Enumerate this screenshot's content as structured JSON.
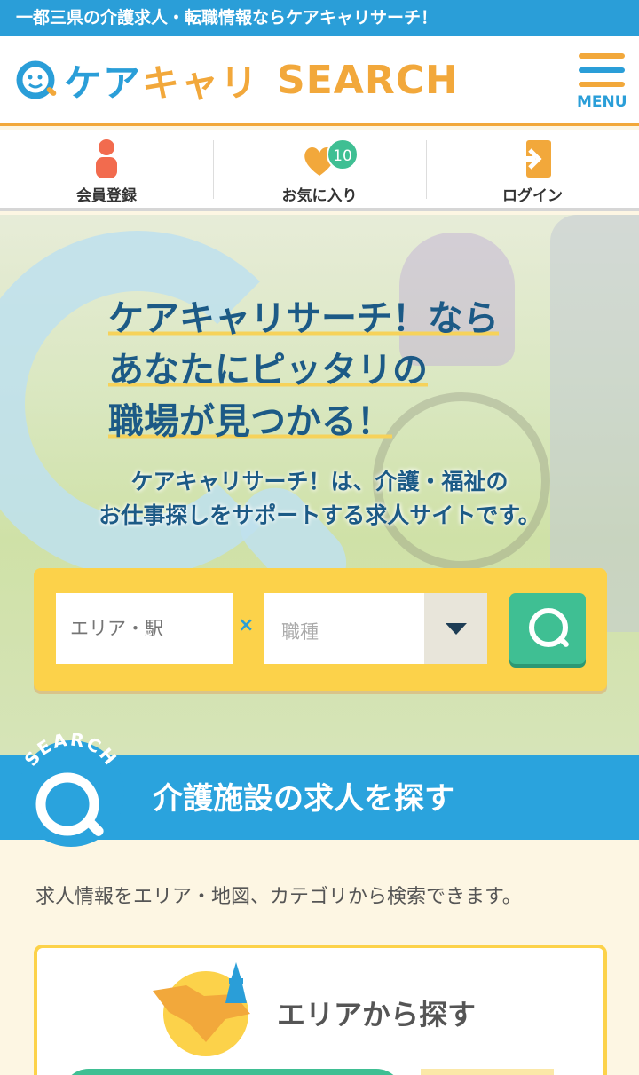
{
  "topbar": {
    "text": "一都三県の介護求人・転職情報ならケアキャリサーチ！"
  },
  "header": {
    "logo_kana_1": "ケア",
    "logo_kana_2": "キャリ",
    "logo_latin": "SEARCH",
    "menu_label": "MENU"
  },
  "quicknav": {
    "items": [
      {
        "label": "会員登録",
        "icon": "person-icon"
      },
      {
        "label": "お気に入り",
        "icon": "heart-icon",
        "badge": "10"
      },
      {
        "label": "ログイン",
        "icon": "login-icon"
      }
    ]
  },
  "hero": {
    "title_lines": [
      "ケアキャリサーチ！なら",
      "あなたにピッタリの",
      "職場が見つかる！"
    ],
    "subtitle_lines": [
      "ケアキャリサーチ！は、介護・福祉の",
      "お仕事探しをサポートする求人サイトです。"
    ]
  },
  "search": {
    "area_placeholder": "エリア・駅",
    "times": "×",
    "job_placeholder": "職種"
  },
  "section": {
    "badge_text": "SEARCH",
    "title": "介護施設の求人を探す",
    "intro": "求人情報をエリア・地図、カテゴリから検索できます。"
  },
  "area_card": {
    "title": "エリアから探す"
  },
  "colors": {
    "brand_blue": "#2a9ed8",
    "brand_orange": "#f2a83b",
    "accent_green": "#3fbf93",
    "search_yellow": "#fcd24a"
  }
}
